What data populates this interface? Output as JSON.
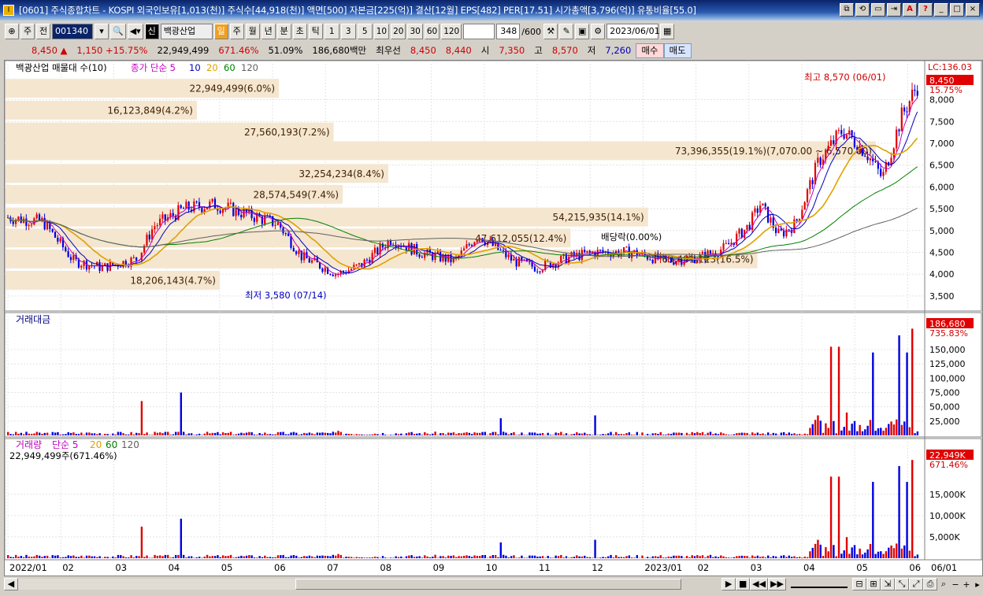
{
  "window": {
    "title": "[0601] 주식종합차트 - KOSPI 외국인보유[1,013(천)] 주식수[44,918(천)] 액면[500] 자본금[225(억)] 결산[12월] EPS[482] PER[17.51] 시가총액[3,796(억)] 유통비율[55.0]",
    "buttons": [
      "⧉",
      "⟲",
      "▭",
      "⇥",
      "A",
      "?",
      "_",
      "□",
      "×"
    ]
  },
  "toolbar": {
    "period_sel": "주",
    "prev": "전",
    "code": "001340",
    "stock_name": "백광산업",
    "stock_tag": "신",
    "period_buttons": [
      "일",
      "주",
      "월",
      "년",
      "분",
      "초",
      "틱"
    ],
    "active_period": "일",
    "interval_buttons": [
      "1",
      "3",
      "5",
      "10",
      "20",
      "30",
      "60",
      "120"
    ],
    "count": "348",
    "count_max": "/600",
    "date": "2023/06/01"
  },
  "infobar": {
    "price": "8,450 ▲",
    "change": "1,150 +15.75%",
    "volume": "22,949,499",
    "volume_pct": "671.46%",
    "rate": "51.09%",
    "amount": "186,680백만",
    "bid_label": "최우선",
    "bid1": "8,450",
    "bid2": "8,440",
    "open_label": "시",
    "open": "7,350",
    "high_label": "고",
    "high": "8,570",
    "low_label": "저",
    "low": "7,260",
    "buy": "매수",
    "sell": "매도"
  },
  "price_panel": {
    "legend_title": "백광산업 매물대 수(10)",
    "legend_ma": [
      "종가 단순 5",
      "10",
      "20",
      "60",
      "120"
    ],
    "ma_colors": [
      "#c000c0",
      "#0000c0",
      "#e0a000",
      "#008000",
      "#606060"
    ],
    "lc_label": "LC:136.03",
    "current_price": "8,450",
    "current_pct": "15.75%",
    "high_note": "최고 8,570 (06/01)",
    "low_note": "최저 3,580 (07/14)",
    "div_note": "배당락(0.00%)",
    "y_ticks": [
      "8,000",
      "7,500",
      "7,000",
      "6,500",
      "6,000",
      "5,500",
      "5,000",
      "4,500",
      "4,000",
      "3,500"
    ],
    "volume_profile": [
      {
        "label": "22,949,499(6.0%)",
        "level": 8250,
        "pct": 6.0
      },
      {
        "label": "16,123,849(4.2%)",
        "level": 7750,
        "pct": 4.2
      },
      {
        "label": "27,560,193(7.2%)",
        "level": 7250,
        "pct": 7.2
      },
      {
        "label": "73,396,355(19.1%)(7,070.00 ~ 6,570.00)",
        "level": 6820,
        "pct": 19.1
      },
      {
        "label": "32,254,234(8.4%)",
        "level": 6300,
        "pct": 8.4
      },
      {
        "label": "28,574,549(7.4%)",
        "level": 5820,
        "pct": 7.4
      },
      {
        "label": "54,215,935(14.1%)",
        "level": 5300,
        "pct": 14.1
      },
      {
        "label": "47,612,055(12.4%)",
        "level": 4820,
        "pct": 12.4
      },
      {
        "label": "63,481,123(16.5%)",
        "level": 4340,
        "pct": 16.5
      },
      {
        "label": "18,206,143(4.7%)",
        "level": 3850,
        "pct": 4.7
      }
    ]
  },
  "amount_panel": {
    "title": "거래대금",
    "current": "186,680",
    "current_pct": "735.83%",
    "y_ticks": [
      "150,000",
      "125,000",
      "100,000",
      "75,000",
      "50,000",
      "25,000"
    ]
  },
  "volume_panel": {
    "title": "거래량",
    "legend_ma": [
      "단순 5",
      "20",
      "60",
      "120"
    ],
    "value_text": "22,949,499주(671.46%)",
    "current": "22,949K",
    "current_pct": "671.46%",
    "y_ticks": [
      "15,000K",
      "10,000K",
      "5,000K"
    ]
  },
  "x_axis": [
    "2022/01",
    "02",
    "03",
    "04",
    "05",
    "06",
    "07",
    "08",
    "09",
    "10",
    "11",
    "12",
    "2023/01",
    "02",
    "03",
    "04",
    "05",
    "06",
    "06/01"
  ],
  "colors": {
    "up": "#e00000",
    "down": "#0000e0",
    "profile": "#f5e6d0"
  }
}
